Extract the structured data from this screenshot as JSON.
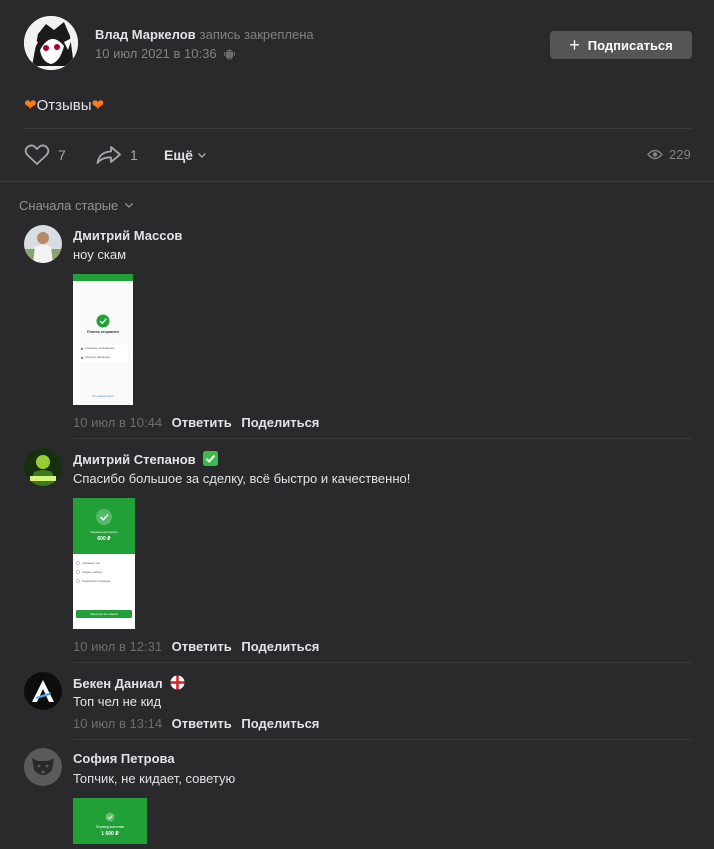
{
  "post": {
    "author_name": "Влад Маркелов",
    "author_status": "запись закреплена",
    "date": "10 июл 2021 в 10:36",
    "subscribe_label": "Подписаться",
    "text": "Отзывы",
    "heart_emoji": "❤",
    "likes": "7",
    "shares": "1",
    "more_label": "Ещё",
    "views": "229"
  },
  "comments": {
    "sort_label": "Сначала старые",
    "items": [
      {
        "name": "Дмитрий Массов",
        "text": "ноу скам",
        "time": "10 июл в 10:44",
        "reply": "Ответить",
        "share": "Поделиться",
        "attachment_texts": [
          "Платеж отправлен",
          "Сохранить изображение",
          "Получить квитанцию",
          "На главный экран"
        ]
      },
      {
        "name": "Дмитрий Степанов",
        "text": "Спасибо большое за сделку, всё быстро и качественно!",
        "time": "10 июл в 12:31",
        "reply": "Ответить",
        "share": "Поделиться",
        "attachment_texts": [
          "Перевод доставлен",
          "600 ₽",
          "Сохранить чек",
          "Создать шаблон",
          "Подробности операции",
          "Вернуться на главный"
        ]
      },
      {
        "name": "Бекен Даниал",
        "text": "Топ чел не кид",
        "time": "10 июл в 13:14",
        "reply": "Ответить",
        "share": "Поделиться"
      },
      {
        "name": "София Петрова",
        "text": "Топчик, не кидает, советую",
        "attachment_texts": [
          "Перевод выполнен",
          "1 600 ₽"
        ]
      }
    ]
  },
  "colors": {
    "background": "#2a2a2c",
    "button": "#555557",
    "sber_green": "#21a038",
    "muted_text": "#828282"
  }
}
